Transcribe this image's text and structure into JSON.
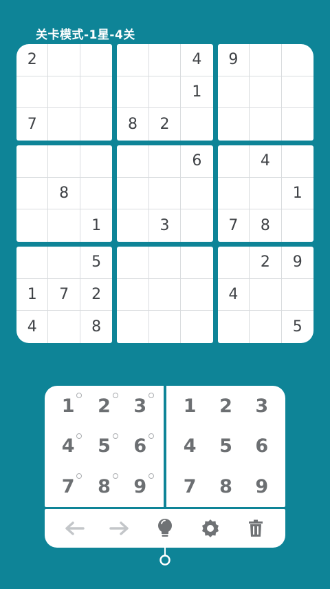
{
  "header": {
    "title": "关卡模式-1星-4关"
  },
  "board": {
    "boxes": [
      {
        "cells": [
          "2",
          "",
          "",
          "",
          "",
          "",
          "7",
          "",
          ""
        ]
      },
      {
        "cells": [
          "",
          "",
          "4",
          "",
          "",
          "1",
          "8",
          "2",
          ""
        ]
      },
      {
        "cells": [
          "9",
          "",
          "",
          "",
          "",
          "",
          "",
          "",
          ""
        ]
      },
      {
        "cells": [
          "",
          "",
          "",
          "",
          "8",
          "",
          "",
          "",
          "1"
        ]
      },
      {
        "cells": [
          "",
          "",
          "6",
          "",
          "",
          "",
          "",
          "3",
          ""
        ]
      },
      {
        "cells": [
          "",
          "4",
          "",
          "",
          "",
          "1",
          "7",
          "8",
          ""
        ]
      },
      {
        "cells": [
          "",
          "",
          "5",
          "1",
          "7",
          "2",
          "4",
          "",
          "8"
        ]
      },
      {
        "cells": [
          "",
          "",
          "",
          "",
          "",
          "",
          "",
          "",
          ""
        ]
      },
      {
        "cells": [
          "",
          "2",
          "9",
          "4",
          "",
          "",
          "",
          "",
          "5"
        ]
      }
    ]
  },
  "number_pad": {
    "note_keys": [
      "1",
      "2",
      "3",
      "4",
      "5",
      "6",
      "7",
      "8",
      "9"
    ],
    "value_keys": [
      "1",
      "2",
      "3",
      "4",
      "5",
      "6",
      "7",
      "8",
      "9"
    ]
  },
  "toolbar": {
    "items": [
      "undo-icon",
      "redo-icon",
      "hint-bulb-icon",
      "settings-gear-icon",
      "delete-trash-icon"
    ]
  },
  "colors": {
    "background": "#0e8497",
    "panel": "#ffffff",
    "digit": "#3f4246",
    "pad_digit": "#6c6f72",
    "icon_active": "#6f7275",
    "icon_disabled": "#c3c6c9"
  }
}
